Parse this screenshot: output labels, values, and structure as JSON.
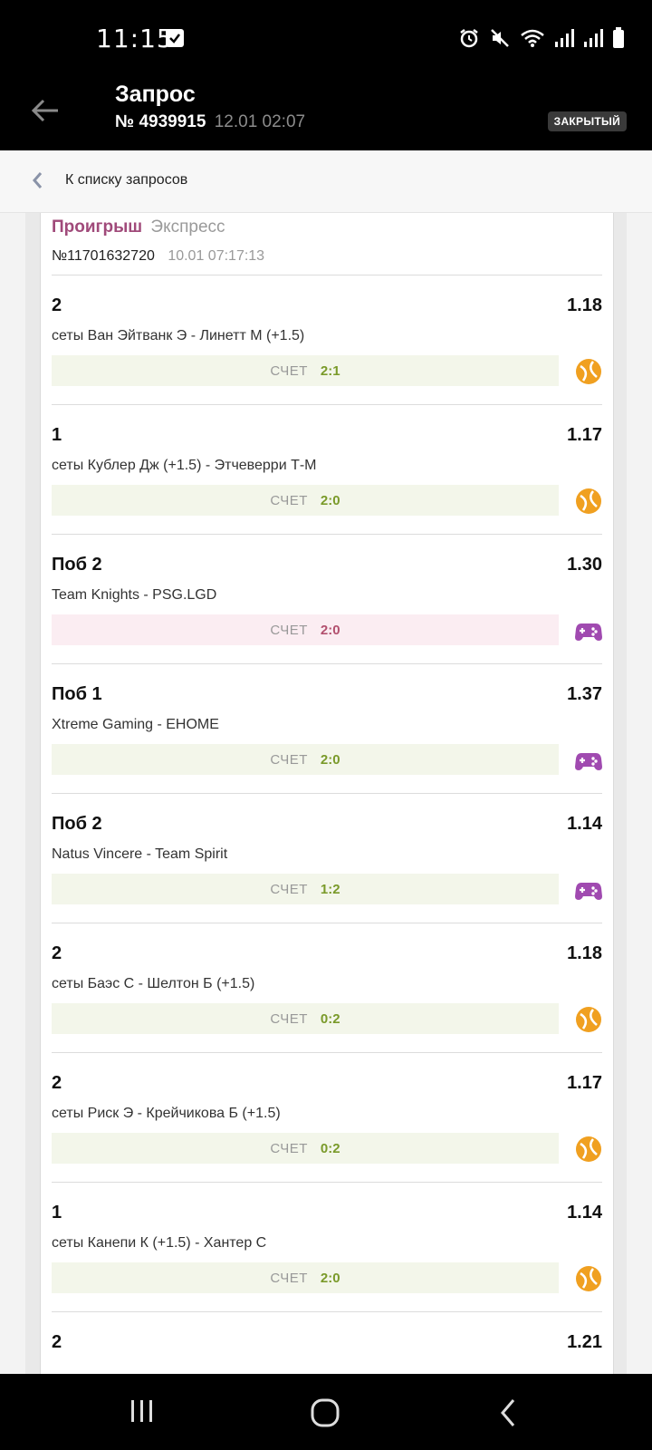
{
  "status_bar": {
    "time": "11:15"
  },
  "header": {
    "title": "Запрос",
    "request_number": "№ 4939915",
    "request_date": "12.01 02:07",
    "badge": "ЗАКРЫТЫЙ"
  },
  "nav": {
    "back_label": "К списку запросов"
  },
  "bet": {
    "status": "Проигрыш",
    "type": "Экспресс",
    "id": "№11701632720",
    "date": "10.01 07:17:13",
    "score_label": "СЧЕТ",
    "items": [
      {
        "pick": "2",
        "odds": "1.18",
        "event": "сеты Ван Эйтванк Э - Линетт М (+1.5)",
        "score": "2:1",
        "icon": "tennis-ball-icon",
        "lost": false
      },
      {
        "pick": "1",
        "odds": "1.17",
        "event": "сеты Кублер Дж (+1.5) - Этчеверри Т-М",
        "score": "2:0",
        "icon": "tennis-ball-icon",
        "lost": false
      },
      {
        "pick": "Поб 2",
        "odds": "1.30",
        "event": "Team Knights - PSG.LGD",
        "score": "2:0",
        "icon": "gamepad-icon",
        "lost": true
      },
      {
        "pick": "Поб 1",
        "odds": "1.37",
        "event": "Xtreme Gaming - EHOME",
        "score": "2:0",
        "icon": "gamepad-icon",
        "lost": false
      },
      {
        "pick": "Поб 2",
        "odds": "1.14",
        "event": "Natus Vincere - Team Spirit",
        "score": "1:2",
        "icon": "gamepad-icon",
        "lost": false
      },
      {
        "pick": "2",
        "odds": "1.18",
        "event": "сеты Баэс С - Шелтон Б (+1.5)",
        "score": "0:2",
        "icon": "tennis-ball-icon",
        "lost": false
      },
      {
        "pick": "2",
        "odds": "1.17",
        "event": "сеты Риск Э - Крейчикова Б (+1.5)",
        "score": "0:2",
        "icon": "tennis-ball-icon",
        "lost": false
      },
      {
        "pick": "1",
        "odds": "1.14",
        "event": "сеты Канепи К (+1.5) - Хантер С",
        "score": "2:0",
        "icon": "tennis-ball-icon",
        "lost": false
      },
      {
        "pick": "2",
        "odds": "1.21",
        "event": "",
        "score": "",
        "icon": "tennis-ball-icon",
        "lost": false
      }
    ]
  },
  "colors": {
    "lost": "#a04a7a",
    "win_score": "#7a9a2a",
    "tennis": "#f0a020",
    "gamepad": "#a04ab0"
  }
}
